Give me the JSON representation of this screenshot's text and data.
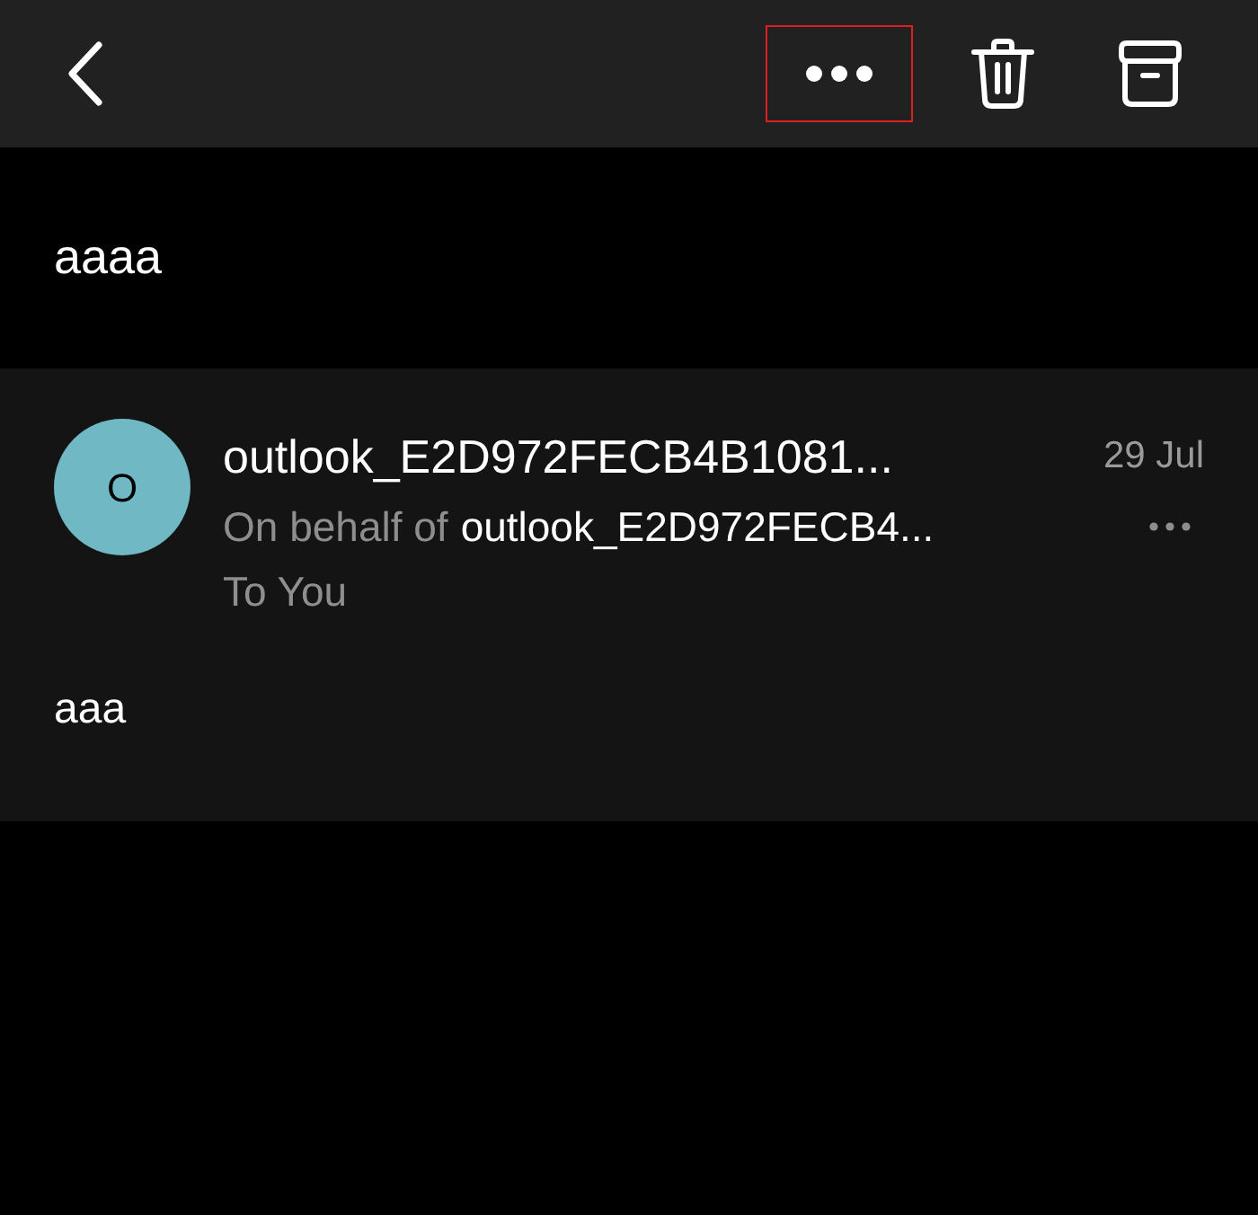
{
  "toolbar": {
    "more_button": {
      "highlighted": true
    }
  },
  "subject": "aaaa",
  "message": {
    "avatar_initial": "O",
    "color": "#6fb8c4",
    "sender": "outlook_E2D972FECB4B1081...",
    "date": "29 Jul",
    "behalf_label": "On behalf of",
    "behalf_sender": "outlook_E2D972FECB4...",
    "recipients": "To You",
    "body": "aaa"
  }
}
